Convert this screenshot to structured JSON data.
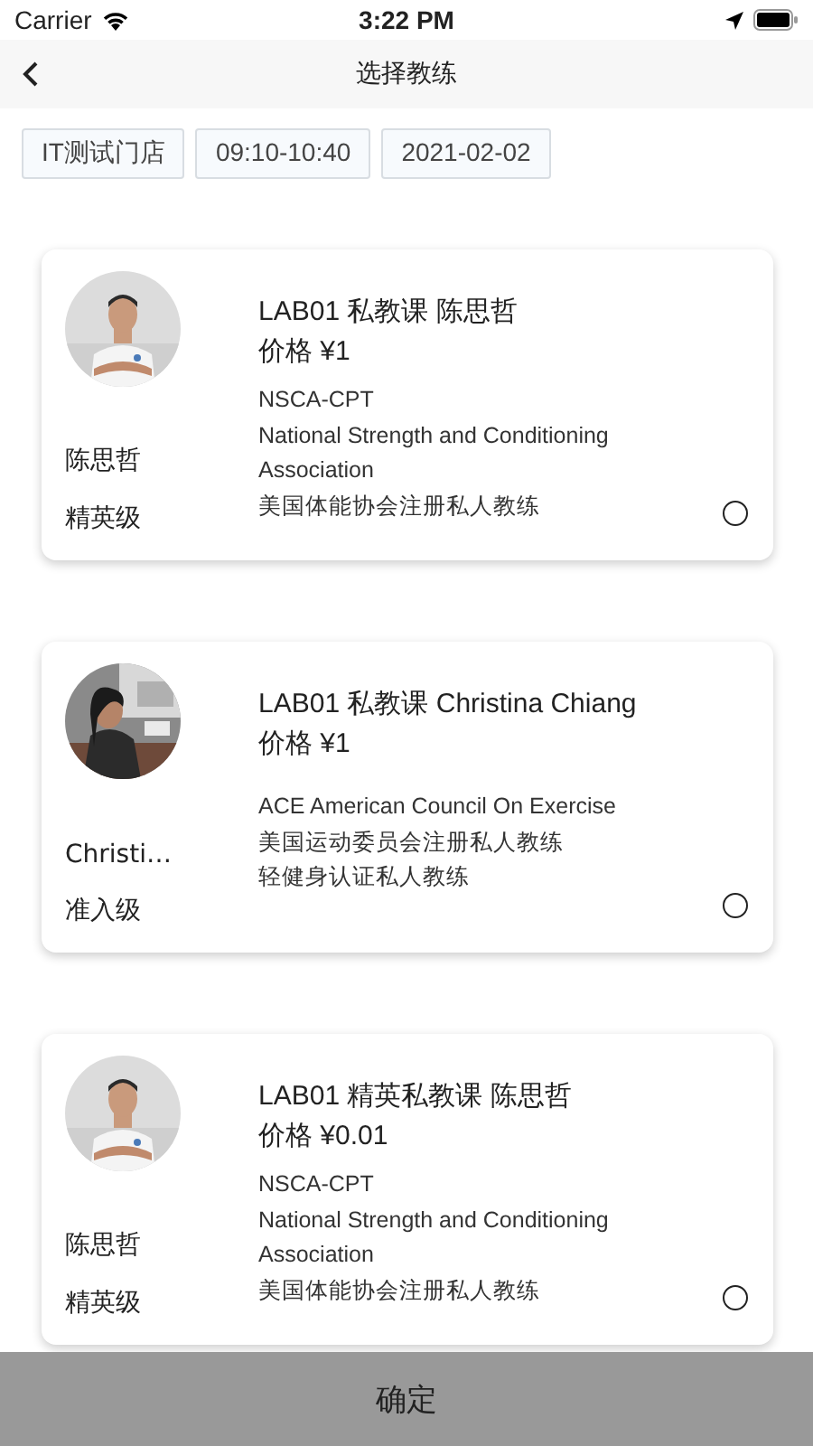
{
  "status_bar": {
    "carrier": "Carrier",
    "time": "3:22 PM"
  },
  "nav": {
    "title": "选择教练"
  },
  "filters": [
    "IT测试门店",
    "09:10-10:40",
    "2021-02-02"
  ],
  "coaches": [
    {
      "name": "陈思哲",
      "level": "精英级",
      "title": "LAB01 私教课 陈思哲",
      "price": "价格 ¥1",
      "certs": [
        "NSCA-CPT",
        "National Strength and Conditioning Association",
        "美国体能协会注册私人教练"
      ],
      "selected": false
    },
    {
      "name": "Christi…",
      "level": "准入级",
      "title": "LAB01 私教课 Christina Chiang",
      "price": "价格 ¥1",
      "certs": [
        "ACE American Council On Exercise",
        "美国运动委员会注册私人教练",
        "轻健身认证私人教练"
      ],
      "selected": false
    },
    {
      "name": "陈思哲",
      "level": "精英级",
      "title": "LAB01 精英私教课 陈思哲",
      "price": "价格 ¥0.01",
      "certs": [
        "NSCA-CPT",
        "National Strength and Conditioning Association",
        "美国体能协会注册私人教练"
      ],
      "selected": false
    }
  ],
  "confirm_button": "确定"
}
